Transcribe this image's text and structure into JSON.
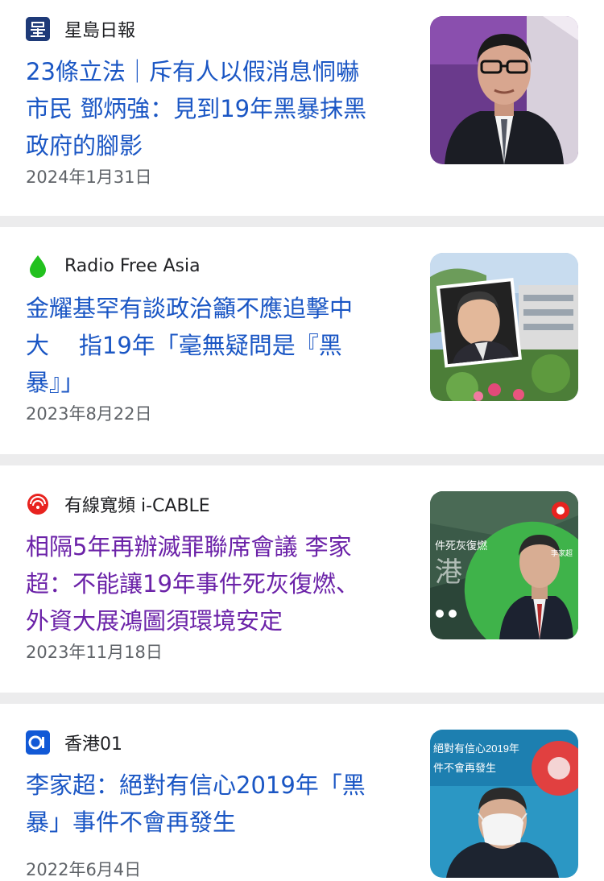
{
  "articles": [
    {
      "source": "星島日報",
      "source_icon": "singtao-logo-icon",
      "title": "23條立法｜斥有人以假消息恫嚇\n市民 鄧炳強：見到19年黑暴抹黑\n政府的腳影",
      "date": "2024年1月31日",
      "visited": false
    },
    {
      "source": "Radio Free Asia",
      "source_icon": "rfa-logo-icon",
      "title": "金耀基罕有談政治籲不應追擊中\n大    指19年「毫無疑問是『黑\n暴』」",
      "date": "2023年8月22日",
      "visited": false
    },
    {
      "source": "有線寬頻 i-CABLE",
      "source_icon": "icable-logo-icon",
      "title": "相隔5年再辦滅罪聯席會議 李家\n超：不能讓19年事件死灰復燃、\n外資大展鴻圖須環境安定",
      "date": "2023年11月18日",
      "visited": true,
      "thumb_text": "件死灰復燃",
      "thumb_text2": "李家超"
    },
    {
      "source": "香港01",
      "source_icon": "hk01-logo-icon",
      "title": "李家超：絕對有信心2019年「黑\n暴」事件不會再發生",
      "date": "2022年6月4日",
      "visited": false,
      "thumb_text": "絕對有信心2019年",
      "thumb_text2": "件不會再發生"
    }
  ],
  "colors": {
    "link": "#1a56c4",
    "visited_link": "#6b22a8",
    "date": "#5f6368",
    "separator": "#ececed"
  }
}
